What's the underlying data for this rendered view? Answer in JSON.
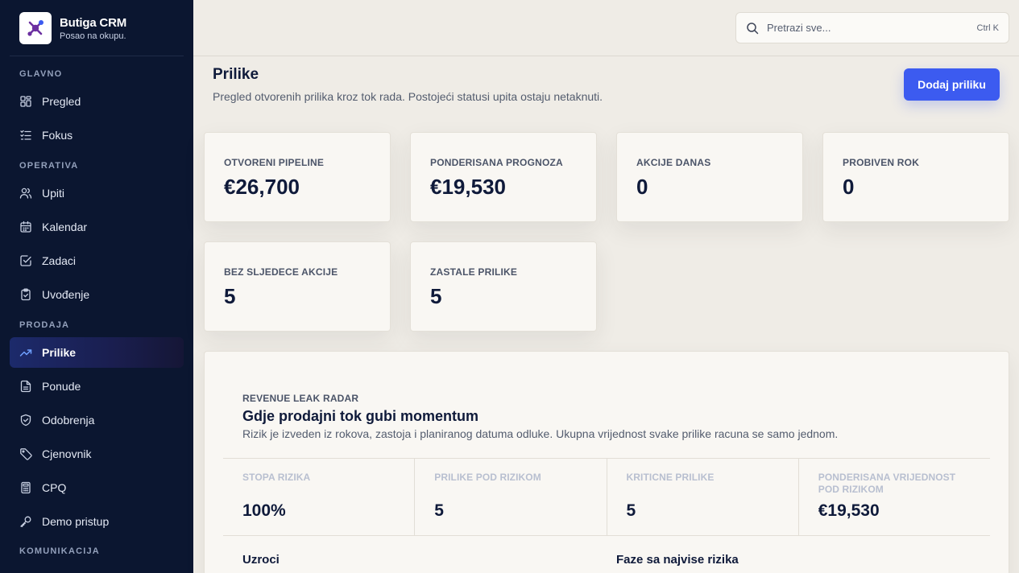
{
  "brand": {
    "name": "Butiga CRM",
    "tagline": "Posao na okupu."
  },
  "sidebar": {
    "sections": [
      {
        "label": "GLAVNO"
      },
      {
        "label": "OPERATIVA"
      },
      {
        "label": "PRODAJA"
      },
      {
        "label": "KOMUNIKACIJA"
      }
    ],
    "items": [
      {
        "label": "Pregled",
        "icon": "grid-icon"
      },
      {
        "label": "Fokus",
        "icon": "list-check-icon"
      },
      {
        "label": "Upiti",
        "icon": "users-icon"
      },
      {
        "label": "Kalendar",
        "icon": "calendar-icon"
      },
      {
        "label": "Zadaci",
        "icon": "checkbox-icon"
      },
      {
        "label": "Uvođenje",
        "icon": "clipboard-icon"
      },
      {
        "label": "Prilike",
        "icon": "trending-up-icon",
        "active": true
      },
      {
        "label": "Ponude",
        "icon": "document-icon"
      },
      {
        "label": "Odobrenja",
        "icon": "shield-check-icon"
      },
      {
        "label": "Cjenovnik",
        "icon": "tag-icon"
      },
      {
        "label": "CPQ",
        "icon": "calculator-icon"
      },
      {
        "label": "Demo pristup",
        "icon": "key-icon"
      }
    ]
  },
  "search": {
    "placeholder": "Pretrazi sve...",
    "shortcut": "Ctrl K"
  },
  "page": {
    "title": "Prilike",
    "subtitle": "Pregled otvorenih prilika kroz tok rada. Postojeći statusi upita ostaju netaknuti.",
    "primary_action": "Dodaj priliku"
  },
  "stats": [
    {
      "label": "OTVORENI PIPELINE",
      "value": "€26,700"
    },
    {
      "label": "PONDERISANA PROGNOZA",
      "value": "€19,530"
    },
    {
      "label": "AKCIJE DANAS",
      "value": "0"
    },
    {
      "label": "PROBIVEN ROK",
      "value": "0"
    },
    {
      "label": "BEZ SLJEDECE AKCIJE",
      "value": "5"
    },
    {
      "label": "ZASTALE PRILIKE",
      "value": "5"
    }
  ],
  "radar": {
    "eyebrow": "REVENUE LEAK RADAR",
    "title": "Gdje prodajni tok gubi momentum",
    "description": "Rizik je izveden iz rokova, zastoja i planiranog datuma odluke. Ukupna vrijednost svake prilike racuna se samo jednom.",
    "metrics": [
      {
        "label": "STOPA RIZIKA",
        "value": "100%"
      },
      {
        "label": "PRILIKE POD RIZIKOM",
        "value": "5"
      },
      {
        "label": "KRITICNE PRILIKE",
        "value": "5"
      },
      {
        "label": "PONDERISANA VRIJEDNOST POD RIZIKOM",
        "value": "€19,530"
      }
    ],
    "causes_heading": "Uzroci",
    "stages_heading": "Faze sa najvise rizika"
  },
  "colors": {
    "sidebar_bg": "#0b1630",
    "accent": "#3c5bf0",
    "page_bg": "#efece6",
    "brand_purple": "#6b2fa0"
  }
}
